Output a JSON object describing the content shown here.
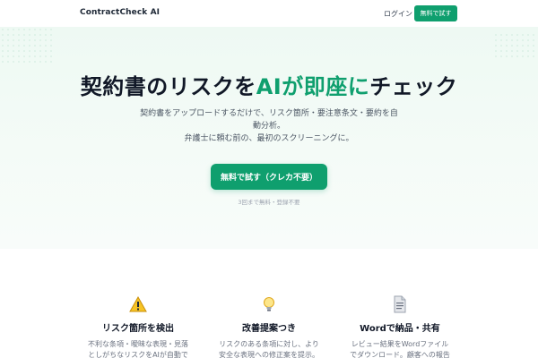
{
  "header": {
    "logo": "ContractCheck AI",
    "login": "ログイン",
    "cta": "無料で試す"
  },
  "hero": {
    "title_part1": "契約書のリスクを",
    "title_accent1": "AIが即座に",
    "title_part2": "チェック",
    "subtitle_line1": "契約書をアップロードするだけで、リスク箇所・要注意条文・要約を自",
    "subtitle_line2": "動分析。",
    "subtitle_line3": "弁護士に頼む前の、最初のスクリーニングに。",
    "cta": "無料で試す（クレカ不要）",
    "note": "3回まで無料・登録不要"
  },
  "features": [
    {
      "icon": "warning-icon",
      "title": "リスク箇所を検出",
      "desc": "不利な条項・曖昧な表現・見落\nとしがちなリスクをAIが自動で"
    },
    {
      "icon": "lightbulb-icon",
      "title": "改善提案つき",
      "desc": "リスクのある条項に対し、より\n安全な表現への修正案を提示。"
    },
    {
      "icon": "document-icon",
      "title": "Wordで納品・共有",
      "desc": "レビュー結果をWordファイル\nでダウンロード。顧客への報告"
    }
  ],
  "colors": {
    "accent": "#0f9f6e",
    "hero_bg": "#eef9f3"
  }
}
